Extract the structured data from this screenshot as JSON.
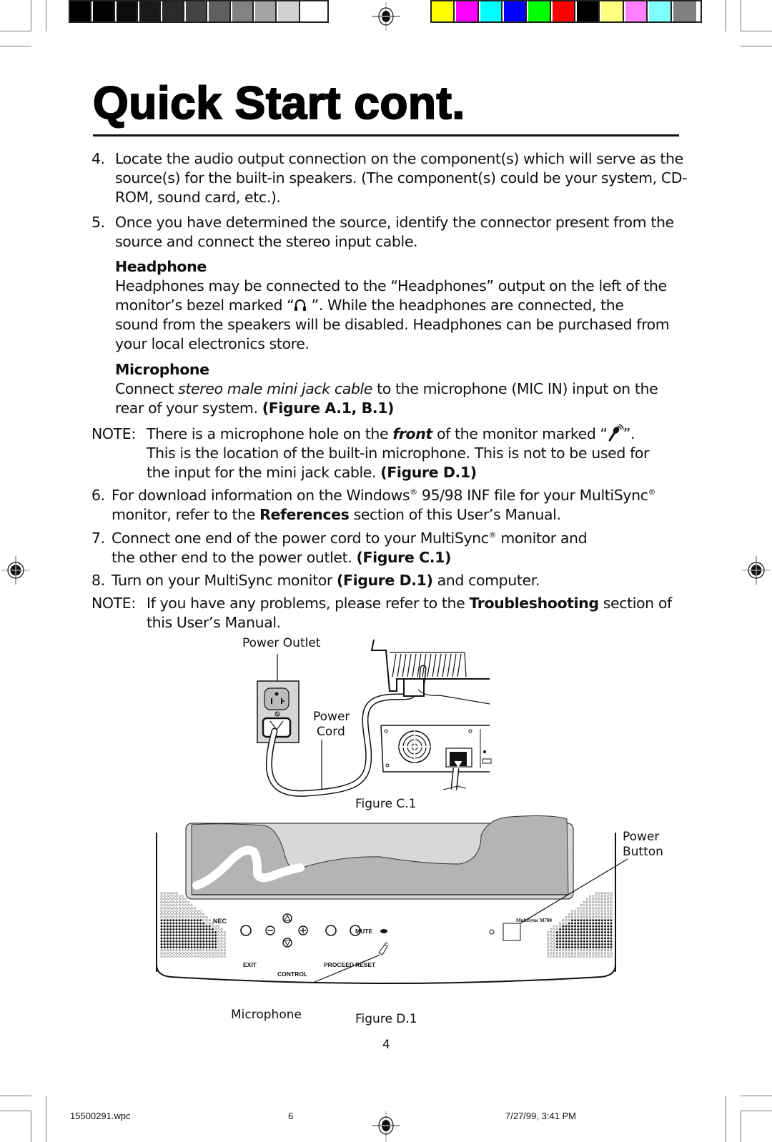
{
  "registration": {
    "grayscale": [
      "#000000",
      "#040404",
      "#0c0c0c",
      "#191919",
      "#2a2a2a",
      "#444444",
      "#5f5f5f",
      "#828282",
      "#a4a4a4",
      "#d0d0d0",
      "#ffffff"
    ],
    "color": [
      "#ffff00",
      "#ff00ff",
      "#00ffff",
      "#0000ff",
      "#00ff00",
      "#ff0000",
      "#000000",
      "#ffff80",
      "#ff80ff",
      "#80ffff",
      "#808080"
    ]
  },
  "page": {
    "title": "Quick Start cont.",
    "page_number": "4"
  },
  "steps": {
    "s4": {
      "num": "4.",
      "lines": [
        "Locate the audio output connection on the component(s) which will serve as the",
        "source(s) for the built-in speakers.  (The component(s) could be your system, CD-",
        "ROM, sound card, etc.)."
      ]
    },
    "s5": {
      "num": "5.",
      "lines": [
        "Once you have determined the source, identify the connector present from the",
        "source and connect the stereo input cable."
      ]
    },
    "headphone": {
      "heading": "Headphone",
      "line1": "Headphones may be connected to the “Headphones” output on the left of the",
      "line2_a": "monitor’s bezel marked “",
      "line2_b": " ”.  While the headphones are connected, the",
      "line3": "sound from the speakers will be disabled.  Headphones can be purchased from",
      "line4": "your local electronics store."
    },
    "microphone": {
      "heading": "Microphone",
      "line1_a": "Connect ",
      "line1_italic": "stereo male mini jack cable",
      "line1_b": " to the microphone (MIC IN) input on the",
      "line2_a": "rear of your system. ",
      "line2_bold": "(Figure A.1, B.1)"
    },
    "note1": {
      "label": "NOTE:",
      "line1_a": "There is a microphone hole on the ",
      "line1_bold_italic": "front",
      "line1_b": " of the monitor marked “",
      "line1_c": "”.",
      "line2": "This is the location of the built-in microphone.  This is not to be used for",
      "line3_a": "the input for the mini jack cable. ",
      "line3_bold": "(Figure D.1)"
    },
    "s6": {
      "num": "6.",
      "line1_a": "For download information on the Windows",
      "reg": "®",
      "line1_b": " 95/98 INF file for your MultiSync",
      "line2_a": "monitor, refer to the ",
      "line2_bold": "References",
      "line2_b": " section of this User’s Manual."
    },
    "s7": {
      "num": "7.",
      "line1_a": "Connect one end of the power cord to your MultiSync",
      "line1_b": " monitor and",
      "line2_a": "the other end to the power outlet. ",
      "line2_bold": "(Figure C.1)"
    },
    "s8": {
      "num": "8.",
      "line1_a": "Turn on your MultiSync monitor ",
      "line1_bold": "(Figure D.1)",
      "line1_b": " and computer."
    },
    "note2": {
      "label": "NOTE:",
      "line1_a": "If you have any problems, please refer to the ",
      "line1_bold": "Troubleshooting",
      "line1_b": " section of",
      "line2": "this User’s Manual."
    }
  },
  "figure_c1": {
    "caption": "Figure C.1",
    "label_outlet": "Power Outlet",
    "label_cord_1": "Power",
    "label_cord_2": "Cord"
  },
  "figure_d1": {
    "caption": "Figure D.1",
    "brand": "NEC",
    "model": "MultiSync M700",
    "label_power_1": "Power",
    "label_power_2": "Button",
    "label_microphone": "Microphone",
    "controls": {
      "mute": "MUTE",
      "exit": "EXIT",
      "control": "CONTROL",
      "proceed": "PROCEED",
      "reset": "RESET"
    },
    "screen_color": "#b4b4b4",
    "bezel_color": "#d8d8d8"
  },
  "footer": {
    "file": "15500291.wpc",
    "sheet": "6",
    "timestamp": "7/27/99, 3:41 PM"
  }
}
